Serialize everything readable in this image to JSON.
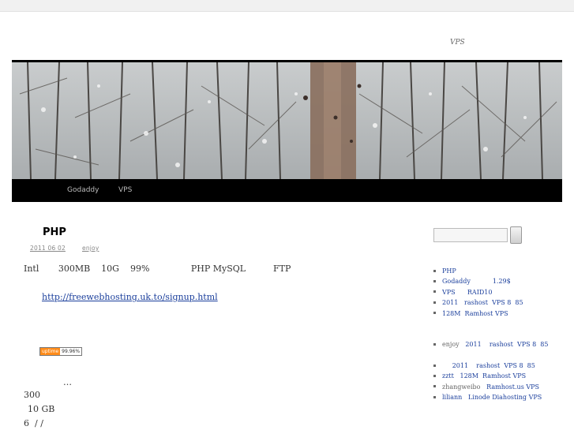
{
  "site": {
    "description": "VPS"
  },
  "nav": {
    "items": [
      "Godaddy",
      "VPS"
    ]
  },
  "post": {
    "title": "PHP",
    "date": "2011  06  02",
    "author": "enjoy",
    "line1": "Intl       300MB    10G    99%               PHP MySQL          FTP",
    "link": "http://freewebhosting.uk.to/signup.html",
    "uptime_label": "uptime",
    "uptime_value": "99.96%",
    "line_ellipsis": "…",
    "line_300": "300",
    "line_10gb": "10 GB",
    "line_6": "6  / /"
  },
  "sidebar": {
    "recent_posts": [
      "PHP",
      "Godaddy           1.29$",
      "VPS      RAID10",
      "2011   rashost  VPS 8  85",
      "128M  Ramhost VPS"
    ],
    "recent_comments": [
      {
        "author": "enjoy",
        "post": "2011    rashost  VPS 8  85"
      },
      {
        "author": "",
        "post": "2011    rashost  VPS 8  85"
      },
      {
        "author": "zztt",
        "post": "128M  Ramhost VPS"
      },
      {
        "author": "zhangweibo",
        "post": "Ramhost.us VPS"
      },
      {
        "author": "liliann",
        "post": "Linode Diahosting VPS"
      }
    ]
  },
  "colors": {
    "link": "#1b3f9c",
    "nav_background": "#000000",
    "badge_orange": "#ff8c1a"
  }
}
